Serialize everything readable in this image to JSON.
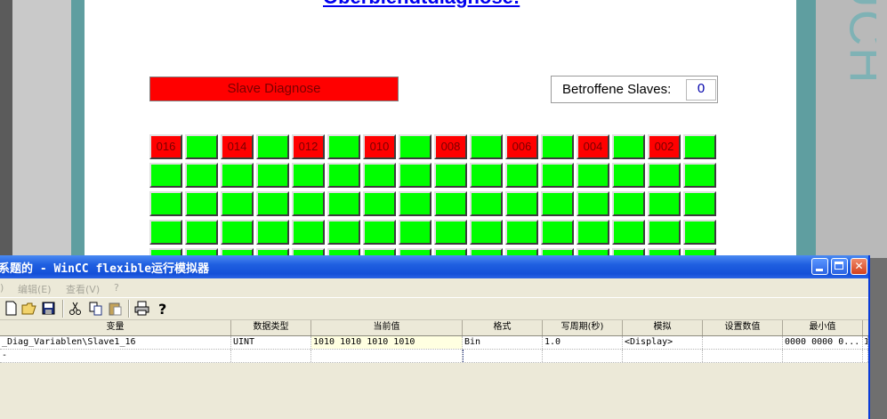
{
  "hmi": {
    "heading": "Oberblendtdiagnose:",
    "brand_text": "TOUCH",
    "slave_diagnose_label": "Slave Diagnose",
    "betroffene_label": "Betroffene Slaves:",
    "betroffene_value": "0",
    "grid_top_labels": [
      "016",
      "",
      "014",
      "",
      "012",
      "",
      "010",
      "",
      "008",
      "",
      "006",
      "",
      "004",
      "",
      "002",
      ""
    ],
    "grid_rows": 5,
    "colors": {
      "status_red": "#ff0000",
      "status_green": "#00ff00",
      "teal": "#5f9ea0"
    }
  },
  "simulator": {
    "title": "标题的 - WinCC flexible运行模拟器",
    "title_visible": "系题的 - WinCC flexible运行模拟器",
    "menu": [
      ")",
      "编辑(E)",
      "查看(V)",
      "?"
    ],
    "toolbar_icons": [
      "new-icon",
      "open-icon",
      "save-icon",
      "cut-icon",
      "copy-icon",
      "paste-icon",
      "print-icon",
      "help-icon"
    ],
    "columns": [
      "变量",
      "数据类型",
      "当前值",
      "格式",
      "写周期(秒)",
      "模拟",
      "设置数值",
      "最小值",
      ""
    ],
    "rows": [
      [
        "_Diag_Variablen\\Slave1_16",
        "UINT",
        "1010 1010 1010 1010",
        "Bin",
        "1.0",
        "<Display>",
        "",
        "0000 0000 0...",
        "1"
      ],
      [
        "-",
        "",
        "",
        "",
        "",
        "",
        "",
        "",
        ""
      ]
    ]
  }
}
